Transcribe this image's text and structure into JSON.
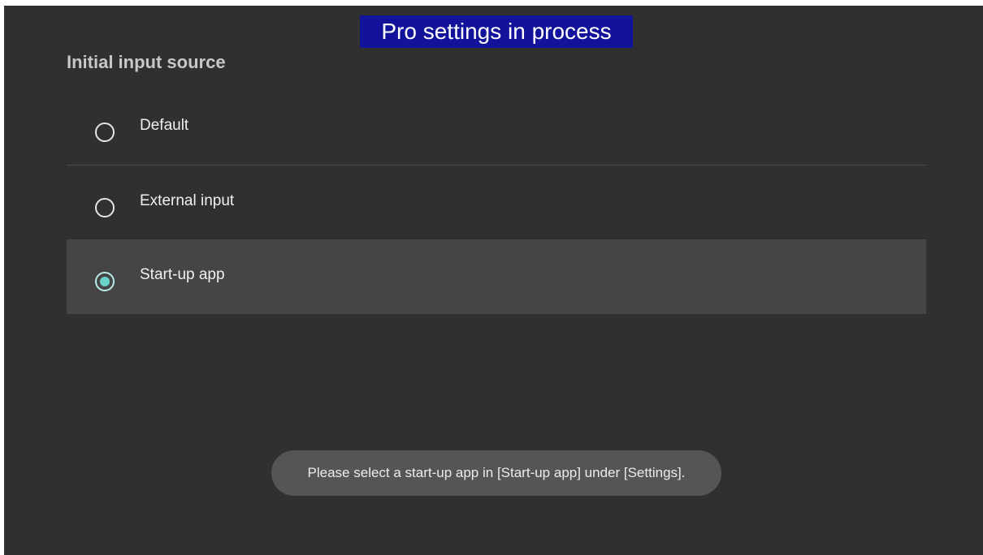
{
  "banner": {
    "text": "Pro settings in process",
    "background_color": "#12129a"
  },
  "section": {
    "title": "Initial input source"
  },
  "options": [
    {
      "label": "Default",
      "selected": false
    },
    {
      "label": "External input",
      "selected": false
    },
    {
      "label": "Start-up app",
      "selected": true
    }
  ],
  "toast": {
    "message": "Please select a start-up app in [Start-up app] under [Settings]."
  },
  "colors": {
    "background": "#303030",
    "selected_row": "#454545",
    "radio_accent": "#6ad3c9"
  }
}
